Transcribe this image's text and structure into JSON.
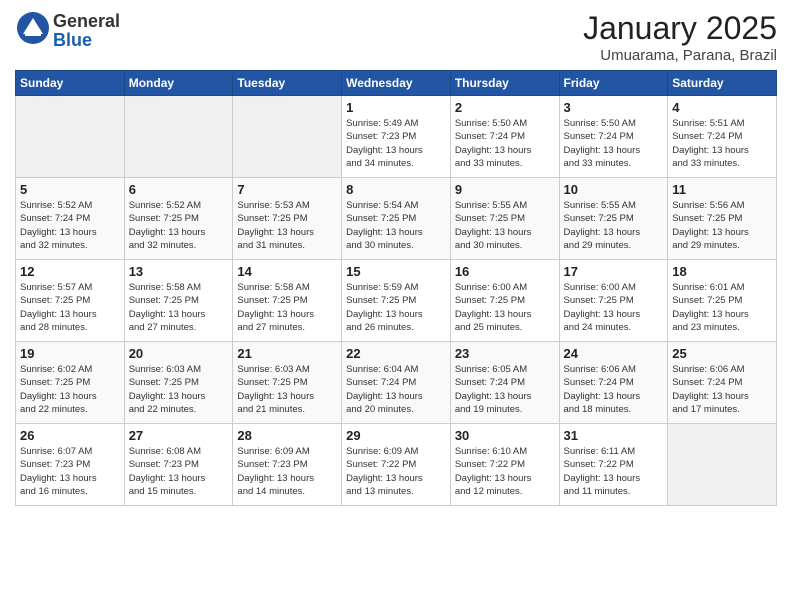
{
  "logo": {
    "general": "General",
    "blue": "Blue"
  },
  "title": "January 2025",
  "subtitle": "Umuarama, Parana, Brazil",
  "days_of_week": [
    "Sunday",
    "Monday",
    "Tuesday",
    "Wednesday",
    "Thursday",
    "Friday",
    "Saturday"
  ],
  "weeks": [
    [
      {
        "day": "",
        "info": ""
      },
      {
        "day": "",
        "info": ""
      },
      {
        "day": "",
        "info": ""
      },
      {
        "day": "1",
        "info": "Sunrise: 5:49 AM\nSunset: 7:23 PM\nDaylight: 13 hours\nand 34 minutes."
      },
      {
        "day": "2",
        "info": "Sunrise: 5:50 AM\nSunset: 7:24 PM\nDaylight: 13 hours\nand 33 minutes."
      },
      {
        "day": "3",
        "info": "Sunrise: 5:50 AM\nSunset: 7:24 PM\nDaylight: 13 hours\nand 33 minutes."
      },
      {
        "day": "4",
        "info": "Sunrise: 5:51 AM\nSunset: 7:24 PM\nDaylight: 13 hours\nand 33 minutes."
      }
    ],
    [
      {
        "day": "5",
        "info": "Sunrise: 5:52 AM\nSunset: 7:24 PM\nDaylight: 13 hours\nand 32 minutes."
      },
      {
        "day": "6",
        "info": "Sunrise: 5:52 AM\nSunset: 7:25 PM\nDaylight: 13 hours\nand 32 minutes."
      },
      {
        "day": "7",
        "info": "Sunrise: 5:53 AM\nSunset: 7:25 PM\nDaylight: 13 hours\nand 31 minutes."
      },
      {
        "day": "8",
        "info": "Sunrise: 5:54 AM\nSunset: 7:25 PM\nDaylight: 13 hours\nand 30 minutes."
      },
      {
        "day": "9",
        "info": "Sunrise: 5:55 AM\nSunset: 7:25 PM\nDaylight: 13 hours\nand 30 minutes."
      },
      {
        "day": "10",
        "info": "Sunrise: 5:55 AM\nSunset: 7:25 PM\nDaylight: 13 hours\nand 29 minutes."
      },
      {
        "day": "11",
        "info": "Sunrise: 5:56 AM\nSunset: 7:25 PM\nDaylight: 13 hours\nand 29 minutes."
      }
    ],
    [
      {
        "day": "12",
        "info": "Sunrise: 5:57 AM\nSunset: 7:25 PM\nDaylight: 13 hours\nand 28 minutes."
      },
      {
        "day": "13",
        "info": "Sunrise: 5:58 AM\nSunset: 7:25 PM\nDaylight: 13 hours\nand 27 minutes."
      },
      {
        "day": "14",
        "info": "Sunrise: 5:58 AM\nSunset: 7:25 PM\nDaylight: 13 hours\nand 27 minutes."
      },
      {
        "day": "15",
        "info": "Sunrise: 5:59 AM\nSunset: 7:25 PM\nDaylight: 13 hours\nand 26 minutes."
      },
      {
        "day": "16",
        "info": "Sunrise: 6:00 AM\nSunset: 7:25 PM\nDaylight: 13 hours\nand 25 minutes."
      },
      {
        "day": "17",
        "info": "Sunrise: 6:00 AM\nSunset: 7:25 PM\nDaylight: 13 hours\nand 24 minutes."
      },
      {
        "day": "18",
        "info": "Sunrise: 6:01 AM\nSunset: 7:25 PM\nDaylight: 13 hours\nand 23 minutes."
      }
    ],
    [
      {
        "day": "19",
        "info": "Sunrise: 6:02 AM\nSunset: 7:25 PM\nDaylight: 13 hours\nand 22 minutes."
      },
      {
        "day": "20",
        "info": "Sunrise: 6:03 AM\nSunset: 7:25 PM\nDaylight: 13 hours\nand 22 minutes."
      },
      {
        "day": "21",
        "info": "Sunrise: 6:03 AM\nSunset: 7:25 PM\nDaylight: 13 hours\nand 21 minutes."
      },
      {
        "day": "22",
        "info": "Sunrise: 6:04 AM\nSunset: 7:24 PM\nDaylight: 13 hours\nand 20 minutes."
      },
      {
        "day": "23",
        "info": "Sunrise: 6:05 AM\nSunset: 7:24 PM\nDaylight: 13 hours\nand 19 minutes."
      },
      {
        "day": "24",
        "info": "Sunrise: 6:06 AM\nSunset: 7:24 PM\nDaylight: 13 hours\nand 18 minutes."
      },
      {
        "day": "25",
        "info": "Sunrise: 6:06 AM\nSunset: 7:24 PM\nDaylight: 13 hours\nand 17 minutes."
      }
    ],
    [
      {
        "day": "26",
        "info": "Sunrise: 6:07 AM\nSunset: 7:23 PM\nDaylight: 13 hours\nand 16 minutes."
      },
      {
        "day": "27",
        "info": "Sunrise: 6:08 AM\nSunset: 7:23 PM\nDaylight: 13 hours\nand 15 minutes."
      },
      {
        "day": "28",
        "info": "Sunrise: 6:09 AM\nSunset: 7:23 PM\nDaylight: 13 hours\nand 14 minutes."
      },
      {
        "day": "29",
        "info": "Sunrise: 6:09 AM\nSunset: 7:22 PM\nDaylight: 13 hours\nand 13 minutes."
      },
      {
        "day": "30",
        "info": "Sunrise: 6:10 AM\nSunset: 7:22 PM\nDaylight: 13 hours\nand 12 minutes."
      },
      {
        "day": "31",
        "info": "Sunrise: 6:11 AM\nSunset: 7:22 PM\nDaylight: 13 hours\nand 11 minutes."
      },
      {
        "day": "",
        "info": ""
      }
    ]
  ]
}
